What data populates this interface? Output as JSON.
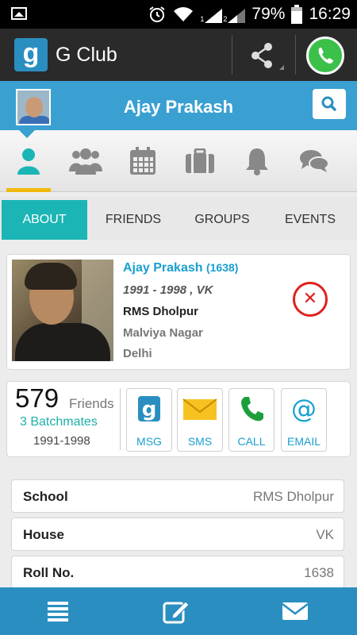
{
  "status_bar": {
    "battery": "79%",
    "time": "16:29",
    "signal_1": "1",
    "signal_2": "2"
  },
  "app_bar": {
    "logo_letter": "g",
    "app_name": "G Club"
  },
  "profile_header": {
    "name": "Ajay Prakash"
  },
  "icon_tabs": [
    {
      "name": "profile",
      "icon": "person-icon",
      "active": true
    },
    {
      "name": "friends",
      "icon": "group-icon",
      "active": false
    },
    {
      "name": "calendar",
      "icon": "calendar-icon",
      "active": false
    },
    {
      "name": "jobs",
      "icon": "briefcase-icon",
      "active": false
    },
    {
      "name": "notifications",
      "icon": "bell-icon",
      "active": false
    },
    {
      "name": "messages",
      "icon": "chat-icon",
      "active": false
    }
  ],
  "text_tabs": {
    "about": "ABOUT",
    "friends": "FRIENDS",
    "groups": "GROUPS",
    "events": "EVENTS"
  },
  "profile": {
    "name": "Ajay Prakash",
    "id": "(1638)",
    "batch": "1991 - 1998 , VK",
    "school": "RMS Dholpur",
    "area": "Malviya Nagar",
    "city": "Delhi"
  },
  "stats": {
    "friends_count": "579",
    "friends_label": "Friends",
    "batchmates": "3 Batchmates",
    "batch_years": "1991-1998"
  },
  "actions": {
    "msg": "MSG",
    "sms": "SMS",
    "call": "CALL",
    "email": "EMAIL"
  },
  "info": {
    "school_label": "School",
    "school_value": "RMS Dholpur",
    "house_label": "House",
    "house_value": "VK",
    "roll_label": "Roll No.",
    "roll_value": "1638"
  },
  "colors": {
    "accent_blue": "#3aa0d2",
    "tab_active": "#1cb5b5",
    "link_blue": "#1a9fd0",
    "remove_red": "#e0201e",
    "indicator_yellow": "#f0b90b"
  }
}
